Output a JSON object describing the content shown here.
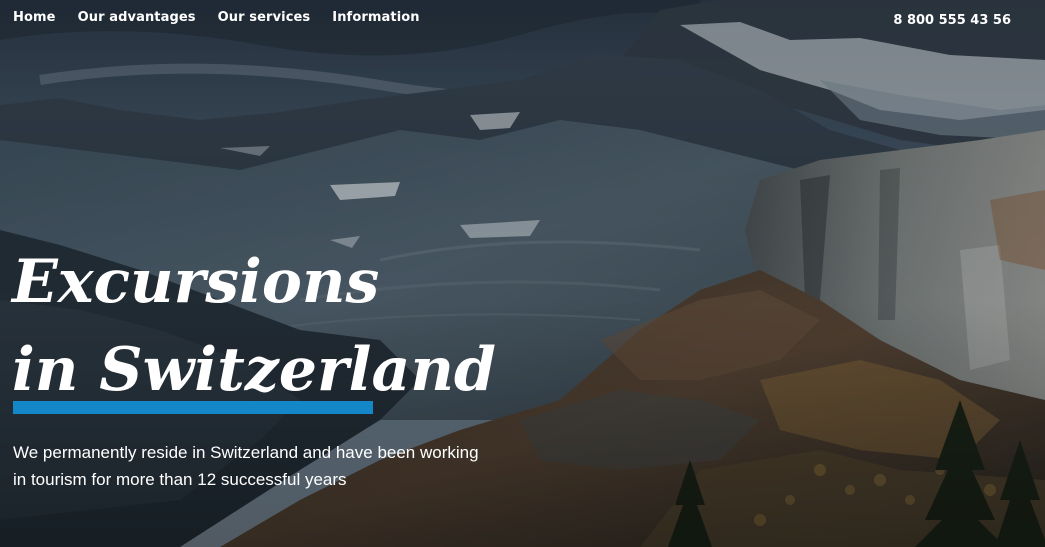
{
  "nav": {
    "items": [
      "Home",
      "Our advantages",
      "Our services",
      "Information"
    ]
  },
  "header": {
    "phone": "8 800 555 43 56"
  },
  "hero": {
    "title_line1": "Excursions",
    "title_line2": "in Switzerland",
    "description_line1": "We permanently reside in Switzerland and have been working",
    "description_line2": "in tourism for more than 12 successful years"
  },
  "colors": {
    "accent": "#1487c9",
    "text": "#ffffff"
  }
}
